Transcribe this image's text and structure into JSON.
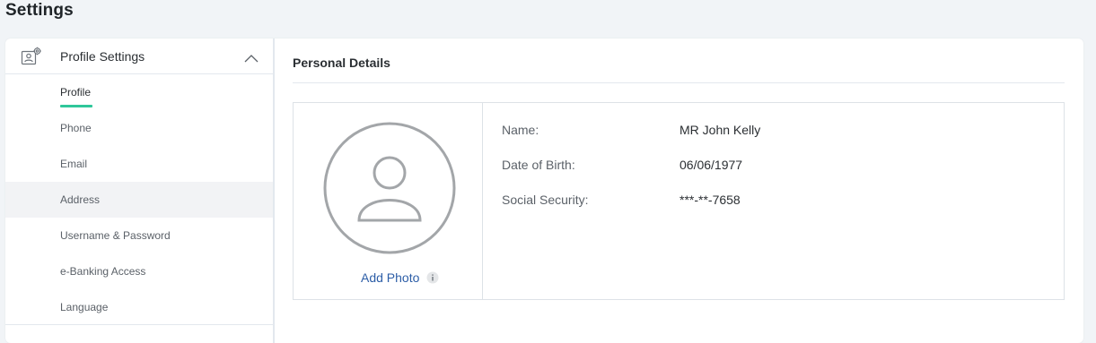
{
  "page": {
    "title": "Settings"
  },
  "sidebar": {
    "header": {
      "title": "Profile Settings",
      "icon": "profile-settings-icon",
      "expanded": true
    },
    "items": [
      {
        "label": "Profile",
        "active": true
      },
      {
        "label": "Phone"
      },
      {
        "label": "Email"
      },
      {
        "label": "Address",
        "hovered": true
      },
      {
        "label": "Username & Password"
      },
      {
        "label": "e-Banking Access"
      },
      {
        "label": "Language"
      }
    ]
  },
  "main": {
    "section_title": "Personal Details",
    "photo": {
      "add_label": "Add Photo",
      "avatar_icon": "user-placeholder-icon",
      "info_icon": "info-icon"
    },
    "details": [
      {
        "label": "Name:",
        "value": "MR John Kelly"
      },
      {
        "label": "Date of Birth:",
        "value": "06/06/1977"
      },
      {
        "label": "Social Security:",
        "value": "***-**-7658"
      }
    ]
  },
  "colors": {
    "background": "#f1f4f7",
    "accent_underline": "#2fc79a",
    "link": "#2d5ea7",
    "hover_row": "#f2f3f5"
  }
}
